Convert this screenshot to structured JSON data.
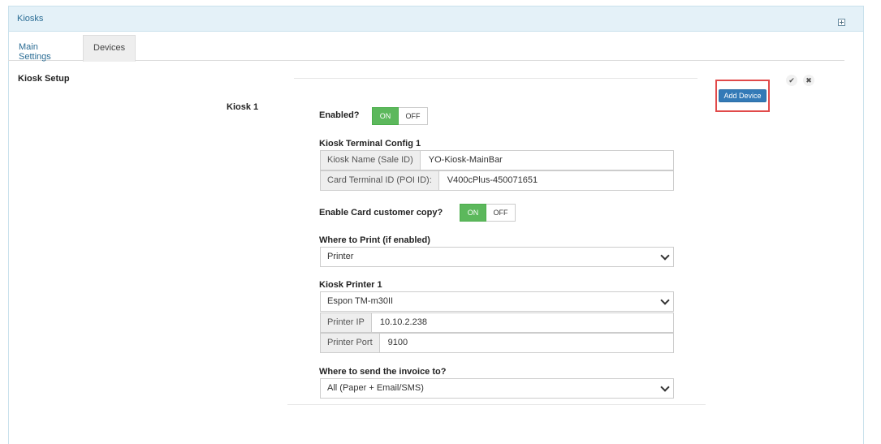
{
  "panel": {
    "title": "Kiosks"
  },
  "tabs": {
    "main_settings": "Main Settings",
    "devices": "Devices"
  },
  "section": {
    "title": "Kiosk Setup"
  },
  "actions": {
    "confirm_glyph": "✔",
    "close_glyph": "✖",
    "add_device": "Add Device"
  },
  "kiosk": {
    "label": "Kiosk 1",
    "enabled": {
      "label": "Enabled?",
      "on": "ON",
      "off": "OFF",
      "value": "ON"
    },
    "terminal": {
      "title": "Kiosk Terminal Config 1",
      "name_label": "Kiosk Name (Sale ID)",
      "name_value": "YO-Kiosk-MainBar",
      "terminal_label": "Card Terminal ID (POI ID):",
      "terminal_value": "V400cPlus-450071651"
    },
    "card_copy": {
      "label": "Enable Card customer copy?",
      "on": "ON",
      "off": "OFF",
      "value": "ON"
    },
    "print_where": {
      "label": "Where to Print (if enabled)",
      "selected": "Printer"
    },
    "printer": {
      "title": "Kiosk Printer 1",
      "model_selected": "Espon TM-m30II",
      "ip_label": "Printer IP",
      "ip_value": "10.10.2.238",
      "port_label": "Printer Port",
      "port_value": "9100"
    },
    "invoice": {
      "label": "Where to send the invoice to?",
      "selected": "All (Paper + Email/SMS)"
    }
  },
  "colors": {
    "accent_blue": "#337ab7",
    "on_green": "#5cb85c",
    "highlight_red": "#e14a4a",
    "panel_header": "#e4f1f8"
  },
  "icons": {
    "expand": "plus-square-icon",
    "confirm": "check-icon",
    "close": "times-icon",
    "dropdown": "chevron-down-icon"
  }
}
